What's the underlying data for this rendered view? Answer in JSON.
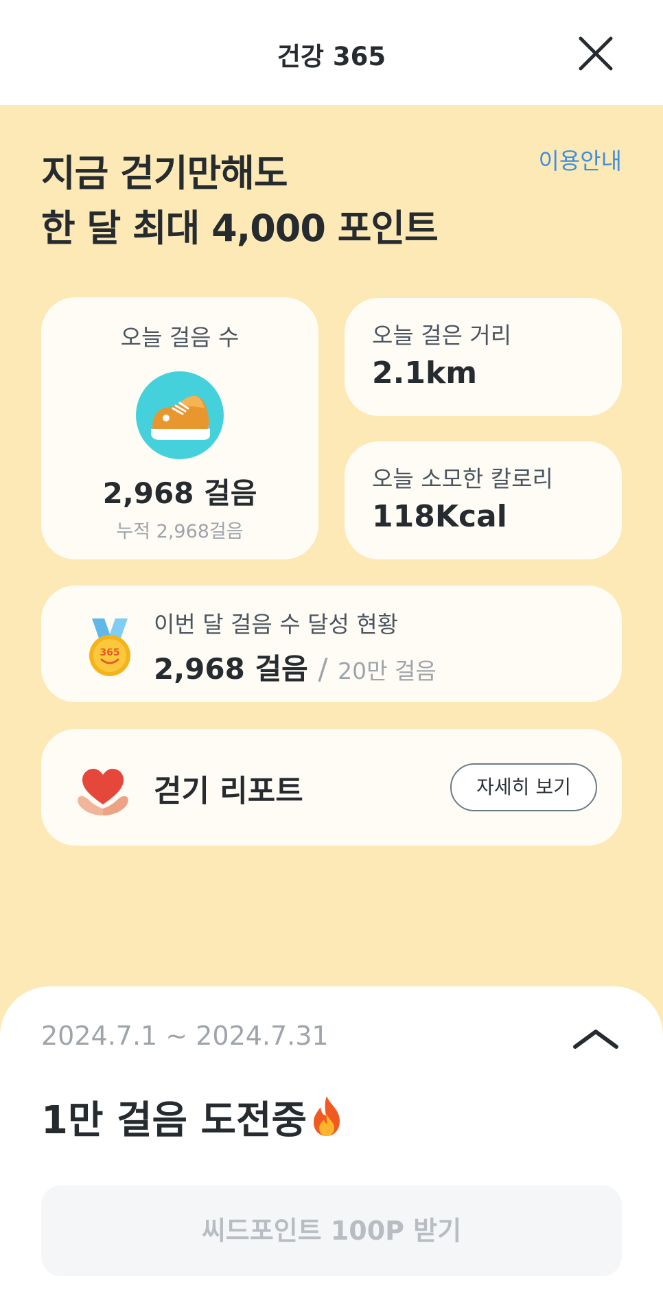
{
  "header": {
    "title": "건강 365",
    "close_icon": "close-icon"
  },
  "hero": {
    "line1": "지금 걷기만해도",
    "line2": "한 달 최대 4,000 포인트",
    "guide_link": "이용안내"
  },
  "today_steps": {
    "label": "오늘 걸음 수",
    "icon": "sneaker-icon",
    "value": "2,968 걸음",
    "cumulative": "누적 2,968걸음"
  },
  "distance": {
    "label": "오늘 걸은 거리",
    "value": "2.1km"
  },
  "calories": {
    "label": "오늘 소모한 칼로리",
    "value": "118Kcal"
  },
  "monthly": {
    "icon": "medal-icon",
    "label": "이번 달 걸음 수 달성 현황",
    "current": "2,968 걸음",
    "separator": "/",
    "goal": "20만 걸음"
  },
  "report": {
    "icon": "heart-hands-icon",
    "title": "걷기 리포트",
    "detail_button": "자세히 보기"
  },
  "challenge_sheet": {
    "period": "2024.7.1 ~ 2024.7.31",
    "collapse_icon": "chevron-up-icon",
    "title": "1만 걸음 도전중",
    "title_icon": "fire-icon",
    "claim_button": "씨드포인트 100P 받기"
  },
  "colors": {
    "background": "#fde9b5",
    "card": "#fffcf5",
    "link": "#3d8fe0",
    "text": "#262b30",
    "muted": "#9ea4aa"
  }
}
